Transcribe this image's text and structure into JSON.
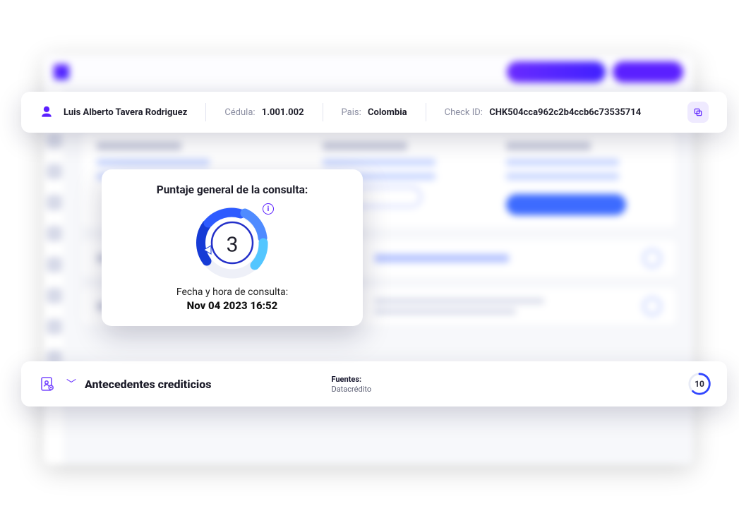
{
  "header": {
    "name": "Luis Alberto Tavera Rodriguez",
    "cedula_label": "Cédula:",
    "cedula_value": "1.001.002",
    "pais_label": "Pais:",
    "pais_value": "Colombia",
    "check_label": "Check ID:",
    "check_value": "CHK504cca962c2b4ccb6c73535714"
  },
  "score_card": {
    "title": "Puntaje general de la consulta:",
    "score": "3",
    "date_label": "Fecha y hora de consulta:",
    "date_value": "Nov 04 2023 16:52"
  },
  "antecedentes": {
    "title": "Antecedentes crediticios",
    "sources_label": "Fuentes:",
    "sources_value": "Datacrédito",
    "badge_value": "10"
  },
  "colors": {
    "brand": "#5b20ff",
    "accent_blue": "#2e5bff",
    "accent_cyan": "#39c2ff"
  }
}
